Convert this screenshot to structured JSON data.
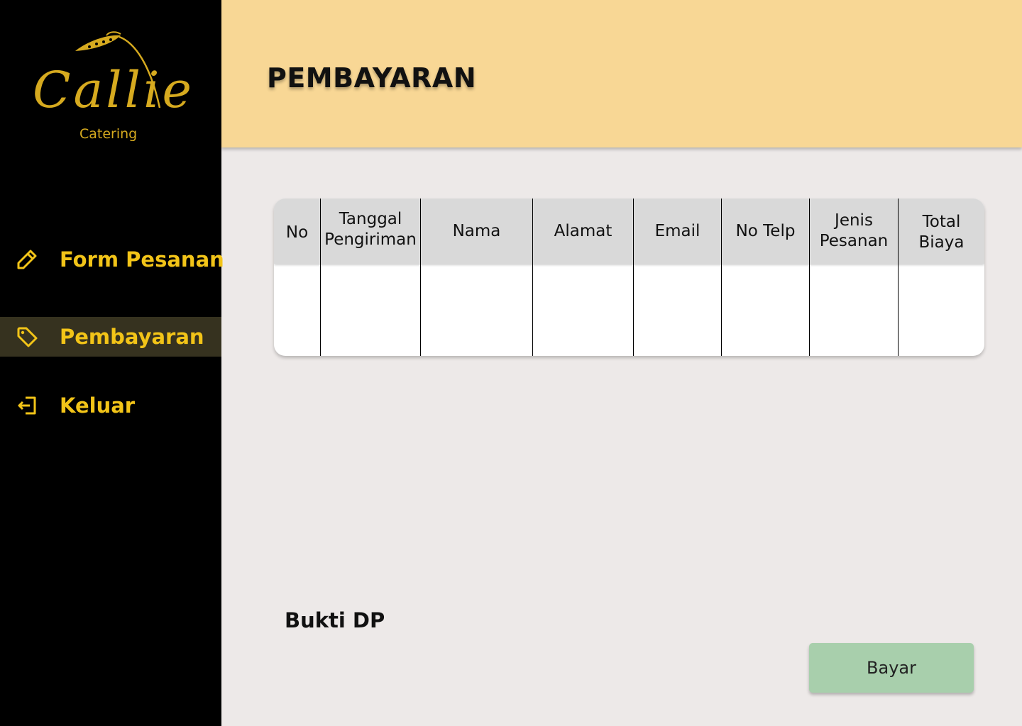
{
  "brand": {
    "name": "Callie",
    "tagline": "Catering",
    "color": "#d6aa1f"
  },
  "sidebar": {
    "items": [
      {
        "label": "Form Pesanan",
        "icon": "pencil-icon",
        "active": false
      },
      {
        "label": "Pembayaran",
        "icon": "tag-icon",
        "active": true
      },
      {
        "label": "Keluar",
        "icon": "logout-icon",
        "active": false
      }
    ],
    "accent": "#f2c418"
  },
  "header": {
    "title": "PEMBAYARAN",
    "background": "#f8d795"
  },
  "table": {
    "columns": [
      "No",
      "Tanggal Pengiriman",
      "Nama",
      "Alamat",
      "Email",
      "No Telp",
      "Jenis Pesanan",
      "Total Biaya"
    ],
    "rows": []
  },
  "upload": {
    "label": "Bukti DP"
  },
  "actions": {
    "pay_label": "Bayar",
    "pay_color": "#a8cfac"
  }
}
